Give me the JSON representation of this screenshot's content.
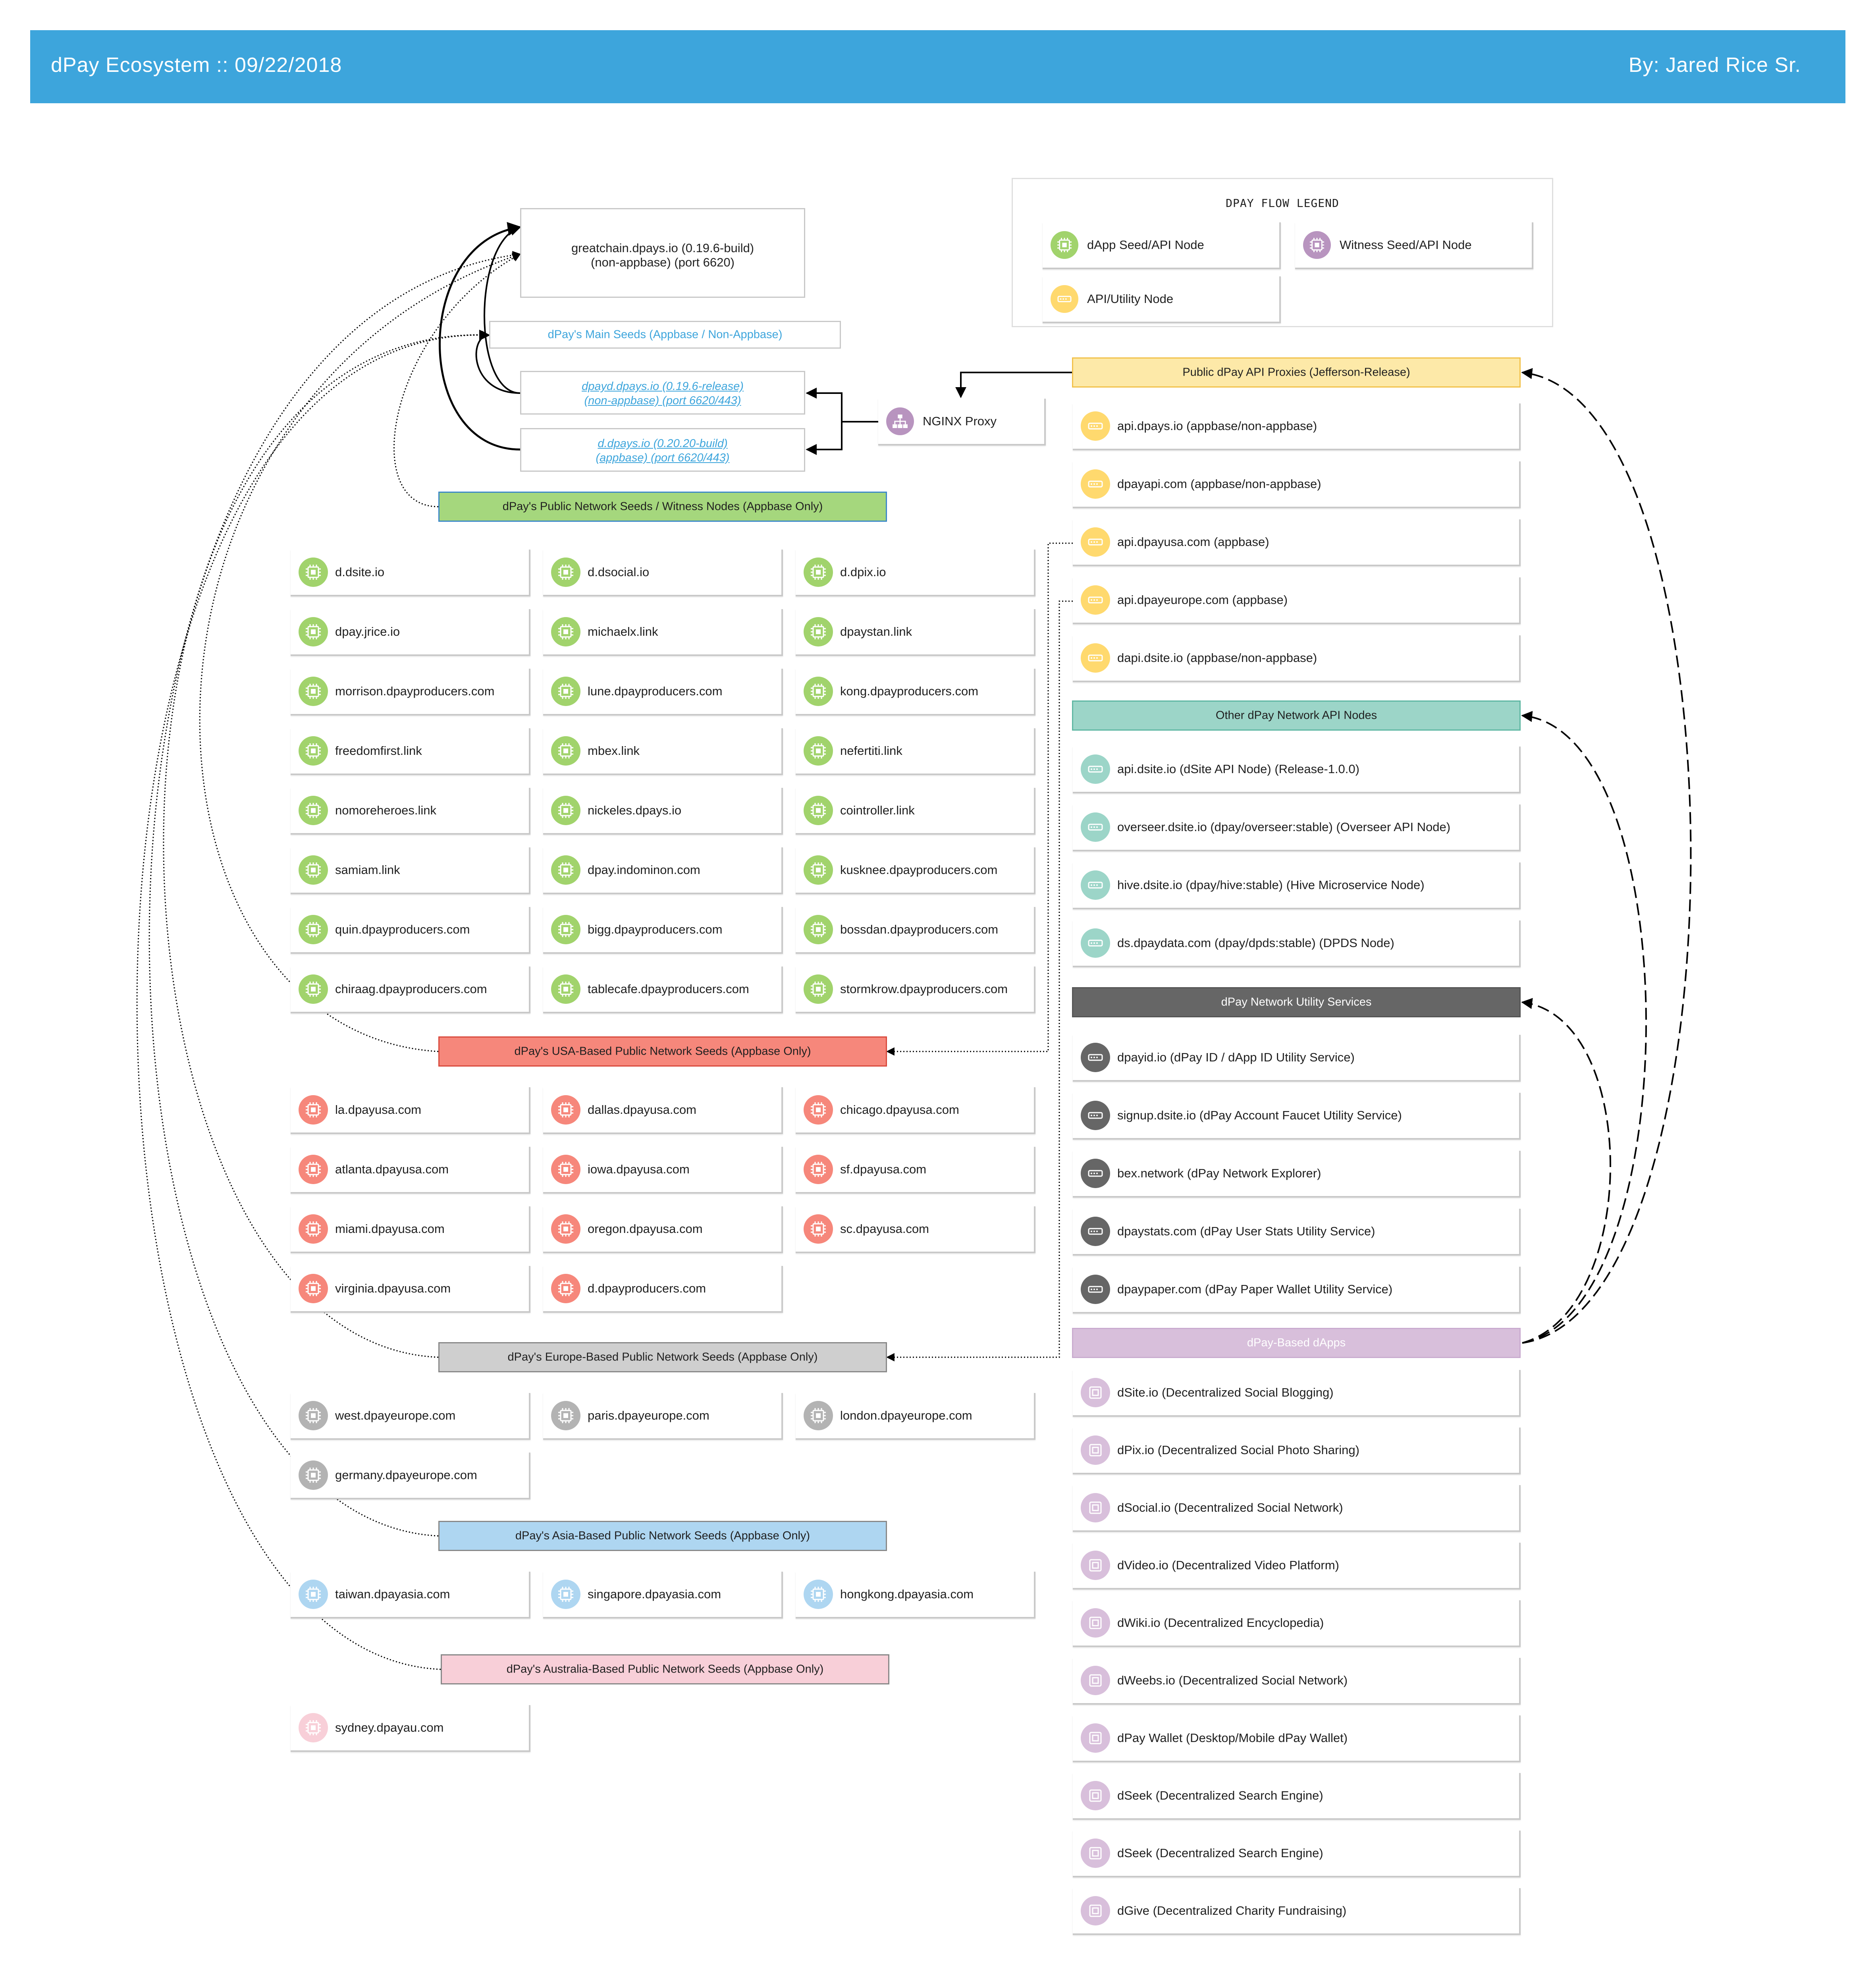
{
  "header": {
    "title": "dPay Ecosystem :: 09/22/2018",
    "author": "By: Jared Rice Sr."
  },
  "colors": {
    "header": "#3da5dc",
    "dapp_node": "#a1d36c",
    "witness_node": "#b894bf",
    "utility_node": "#ffd96e",
    "usa": "#f6877b",
    "europe": "#b3b3b3",
    "asia": "#aed6f1",
    "australia": "#f8cfd8",
    "other_api": "#9cd5c8",
    "utility_services": "#666666",
    "dapps": "#d8bfdb"
  },
  "legend": {
    "title": "DPAY FLOW LEGEND",
    "items": [
      {
        "label": "dApp Seed/API Node",
        "icon": "chip-icon",
        "color": "#a1d36c"
      },
      {
        "label": "Witness Seed/API Node",
        "icon": "chip-icon",
        "color": "#b894bf"
      },
      {
        "label": "API/Utility Node",
        "icon": "server-icon",
        "color": "#ffd96e"
      }
    ]
  },
  "main_seeds": {
    "primary": {
      "line1": "greatchain.dpays.io (0.19.6-build)",
      "line2": "(non-appbase) (port 6620)"
    },
    "group_label": "dPay's Main Seeds (Appbase / Non-Appbase)",
    "seed2": {
      "line1": "dpayd.dpays.io (0.19.6-release)",
      "line2": "(non-appbase) (port 6620/443)"
    },
    "seed3": {
      "line1": "d.dpays.io (0.20.20-build)",
      "line2": "(appbase) (port 6620/443)"
    }
  },
  "nginx": {
    "label": "NGINX Proxy",
    "icon": "sitemap-icon"
  },
  "seed_groups": {
    "public": {
      "label": "dPay's Public Network Seeds / Witness Nodes (Appbase Only)",
      "nodes": [
        "d.dsite.io",
        "d.dsocial.io",
        "d.dpix.io",
        "dpay.jrice.io",
        "michaelx.link",
        "dpaystan.link",
        "morrison.dpayproducers.com",
        "lune.dpayproducers.com",
        "kong.dpayproducers.com",
        "freedomfirst.link",
        "mbex.link",
        "nefertiti.link",
        "nomoreheroes.link",
        "nickeles.dpays.io",
        "cointroller.link",
        "samiam.link",
        "dpay.indominon.com",
        "kusknee.dpayproducers.com",
        "quin.dpayproducers.com",
        "bigg.dpayproducers.com",
        "bossdan.dpayproducers.com",
        "chiraag.dpayproducers.com",
        "tablecafe.dpayproducers.com",
        "stormkrow.dpayproducers.com"
      ]
    },
    "usa": {
      "label": "dPay's USA-Based Public Network Seeds (Appbase Only)",
      "nodes": [
        "la.dpayusa.com",
        "dallas.dpayusa.com",
        "chicago.dpayusa.com",
        "atlanta.dpayusa.com",
        "iowa.dpayusa.com",
        "sf.dpayusa.com",
        "miami.dpayusa.com",
        "oregon.dpayusa.com",
        "sc.dpayusa.com",
        "virginia.dpayusa.com",
        "d.dpayproducers.com"
      ]
    },
    "europe": {
      "label": "dPay's Europe-Based Public Network Seeds (Appbase Only)",
      "nodes": [
        "west.dpayeurope.com",
        "paris.dpayeurope.com",
        "london.dpayeurope.com",
        "germany.dpayeurope.com"
      ]
    },
    "asia": {
      "label": "dPay's Asia-Based Public Network Seeds (Appbase Only)",
      "nodes": [
        "taiwan.dpayasia.com",
        "singapore.dpayasia.com",
        "hongkong.dpayasia.com"
      ]
    },
    "australia": {
      "label": "dPay's Australia-Based Public Network Seeds (Appbase Only)",
      "nodes": [
        "sydney.dpayau.com"
      ]
    }
  },
  "right_groups": {
    "proxies": {
      "label": "Public dPay API Proxies (Jefferson-Release)",
      "nodes": [
        "api.dpays.io (appbase/non-appbase)",
        "dpayapi.com (appbase/non-appbase)",
        "api.dpayusa.com (appbase)",
        "api.dpayeurope.com (appbase)",
        "dapi.dsite.io (appbase/non-appbase)"
      ]
    },
    "other_api": {
      "label": "Other dPay Network API Nodes",
      "nodes": [
        "api.dsite.io (dSite API Node) (Release-1.0.0)",
        "overseer.dsite.io (dpay/overseer:stable) (Overseer API Node)",
        "hive.dsite.io (dpay/hive:stable) (Hive Microservice Node)",
        "ds.dpaydata.com (dpay/dpds:stable) (DPDS Node)"
      ]
    },
    "utility": {
      "label": "dPay Network Utility Services",
      "nodes": [
        "dpayid.io (dPay ID / dApp ID Utility Service)",
        "signup.dsite.io (dPay Account Faucet Utility Service)",
        "bex.network (dPay Network Explorer)",
        "dpaystats.com (dPay User Stats Utility Service)",
        "dpaypaper.com (dPay Paper Wallet Utility Service)"
      ]
    },
    "dapps": {
      "label": "dPay-Based dApps",
      "nodes": [
        "dSite.io (Decentralized Social Blogging)",
        "dPix.io (Decentralized Social Photo Sharing)",
        "dSocial.io (Decentralized Social Network)",
        "dVideo.io (Decentralized Video Platform)",
        "dWiki.io (Decentralized Encyclopedia)",
        "dWeebs.io (Decentralized Social Network)",
        "dPay Wallet (Desktop/Mobile dPay Wallet)",
        "dSeek (Decentralized Search Engine)",
        "dSeek (Decentralized Search Engine)",
        "dGive (Decentralized Charity Fundraising)"
      ]
    }
  }
}
